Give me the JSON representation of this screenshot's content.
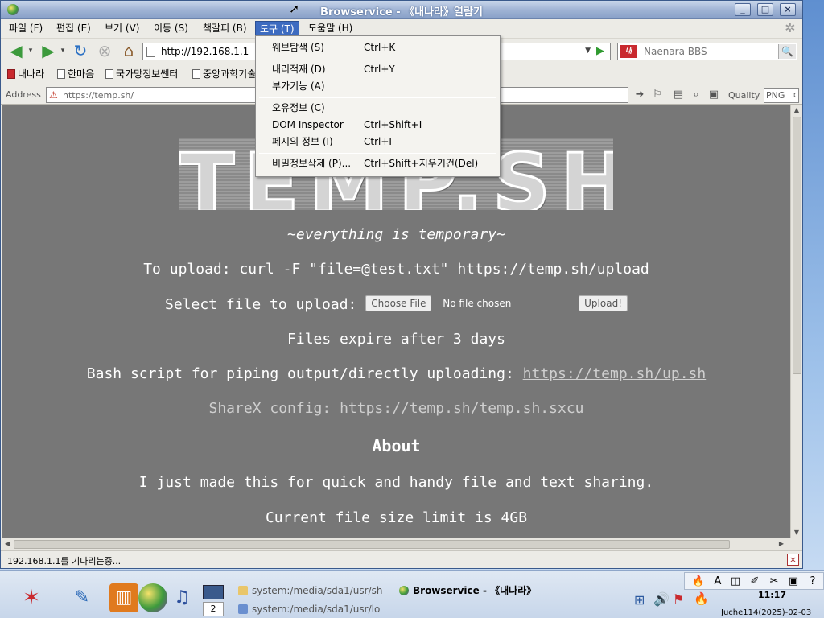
{
  "window": {
    "title": "Browservice - 《내나라》열람기",
    "minimize": "_",
    "maximize": "□",
    "close": "×"
  },
  "menubar": {
    "items": [
      "파일 (F)",
      "편집 (E)",
      "보기 (V)",
      "이동 (S)",
      "책갈피 (B)",
      "도구 (T)",
      "도움말 (H)"
    ],
    "active": "도구 (T)"
  },
  "navbar": {
    "url": "http://192.168.1.1",
    "search_placeholder": "Naenara BBS",
    "search_engine_icon": "naenara-logo"
  },
  "bookmarks": [
    "내나라",
    "한마음",
    "국가망정보쎈터",
    "중앙과학기술"
  ],
  "address": {
    "label": "Address",
    "value": "https://temp.sh/",
    "quality_label": "Quality",
    "quality_value": "PNG"
  },
  "tools_menu": {
    "items": [
      {
        "label": "웨브탐색 (S)",
        "shortcut": "Ctrl+K"
      },
      {
        "label": "내리적재 (D)",
        "shortcut": "Ctrl+Y"
      },
      {
        "label": "부가기능 (A)",
        "shortcut": ""
      },
      {
        "label": "오유정보 (C)",
        "shortcut": ""
      },
      {
        "label": "DOM Inspector",
        "shortcut": "Ctrl+Shift+I"
      },
      {
        "label": "페지의 정보 (I)",
        "shortcut": "Ctrl+I"
      },
      {
        "label": "비밀정보삭제 (P)...",
        "shortcut": "Ctrl+Shift+지우기건(Del)"
      }
    ]
  },
  "page": {
    "logo": "TEMP.SH",
    "tagline": "~everything is temporary~",
    "upload_cmd": "To upload: curl -F \"file=@test.txt\" https://temp.sh/upload",
    "select_label": "Select file to upload:",
    "choose_button": "Choose File",
    "no_file": "No file chosen",
    "upload_button": "Upload!",
    "expire": "Files expire after 3 days",
    "bash_text": "Bash script for piping output/directly uploading:",
    "bash_link": "https://temp.sh/up.sh",
    "sharex_label": "ShareX config:",
    "sharex_link": "https://temp.sh/temp.sh.sxcu",
    "about_heading": "About",
    "about_text": "I just made this for quick and handy file and text sharing.",
    "limit": "Current file size limit is 4GB"
  },
  "status": {
    "text": "192.168.1.1를 기다리는중..."
  },
  "taskbar": {
    "workspace": "2",
    "tasks": [
      "system:/media/sda1/usr/sh",
      "Browservice - 《내나라》",
      "system:/media/sda1/usr/lo"
    ],
    "clock": "11:17",
    "date": "Juche114(2025)-02-03"
  }
}
